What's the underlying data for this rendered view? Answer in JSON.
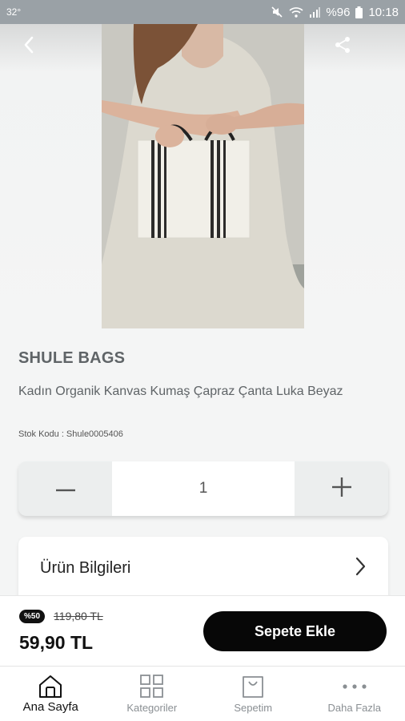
{
  "status_bar": {
    "temperature": "32°",
    "battery": "%96",
    "time": "10:18",
    "icons": [
      "mute-icon",
      "wifi-icon",
      "signal-icon",
      "battery-icon"
    ]
  },
  "header": {
    "back_icon": "chevron-left-icon",
    "share_icon": "share-icon"
  },
  "product": {
    "brand": "SHULE BAGS",
    "title": "Kadın Organik Kanvas Kumaş Çapraz Çanta Luka Beyaz",
    "sku": "Stok Kodu : Shule0005406",
    "image": "woman-holding-canvas-bag-photo"
  },
  "quantity": {
    "value": "1",
    "decrement_icon": "minus-icon",
    "increment_icon": "plus-icon"
  },
  "info_section": {
    "label": "Ürün Bilgileri",
    "icon": "chevron-right-icon"
  },
  "purchase": {
    "discount_badge": "%50",
    "old_price": "119,80 TL",
    "price": "59,90 TL",
    "add_to_cart_label": "Sepete Ekle"
  },
  "bottom_nav": {
    "items": [
      {
        "label": "Ana Sayfa",
        "icon": "home-icon",
        "active": true
      },
      {
        "label": "Kategoriler",
        "icon": "grid-icon",
        "active": false
      },
      {
        "label": "Sepetim",
        "icon": "shopping-bag-icon",
        "active": false
      },
      {
        "label": "Daha Fazla",
        "icon": "more-dots-icon",
        "active": false
      }
    ]
  },
  "colors": {
    "status_bar": "#9aa1a6",
    "accent": "#070707",
    "background": "#f4f5f5",
    "muted_text": "#5f6467"
  }
}
